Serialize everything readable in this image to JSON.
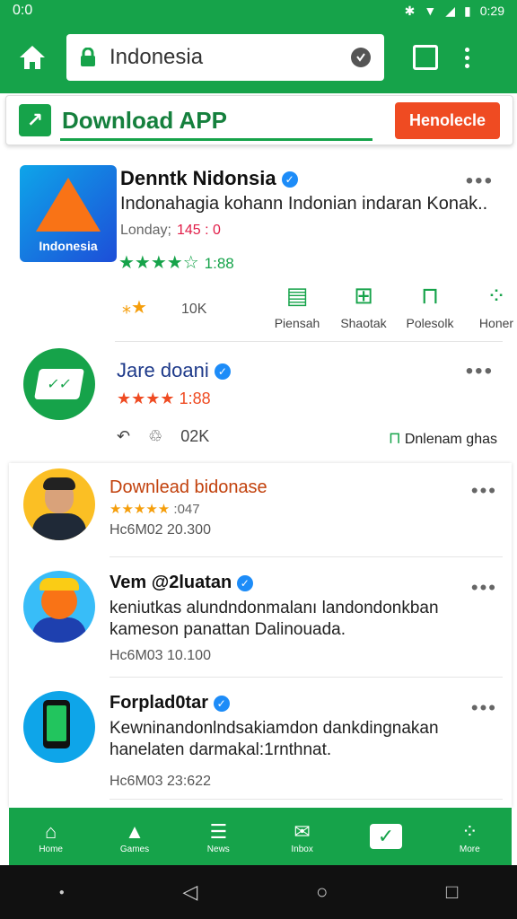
{
  "status_bar": {
    "time_left": "0:0",
    "battery": "0:29"
  },
  "app_bar": {
    "url": "Indonesia"
  },
  "banner": {
    "text": "Download APP",
    "button": "Henolecle"
  },
  "app1": {
    "icon_label": "Indonesia",
    "title": "Denntk Nidonsia",
    "description": "Indonahagia kohann Indonian indaran Konak..",
    "meta_label": "Londay;",
    "meta_value": "145 : 0",
    "stars": "★★★★☆",
    "rating_value": "1:88",
    "downloads_icon": "⁎★",
    "downloads": "10K",
    "actions": [
      {
        "icon": "book-icon",
        "glyph": "▤",
        "label": "Piensah"
      },
      {
        "icon": "robot-icon",
        "glyph": "⊞",
        "label": "Shaotak"
      },
      {
        "icon": "bag-icon",
        "glyph": "⊓",
        "label": "Polesolk"
      },
      {
        "icon": "grid-icon",
        "glyph": "⁘",
        "label": "Honer"
      }
    ]
  },
  "app2": {
    "title": "Jare doani",
    "stars": "★★★★",
    "rating_value": "1:88",
    "downloads": "02K",
    "cta": "Dnlenam ghas"
  },
  "posts": [
    {
      "title": "Downlead bidonase",
      "stars": "★★★★★",
      "sub": ":047",
      "meta": "Hc6M02  20.300",
      "body": []
    },
    {
      "title": "Vem @2luatan",
      "stars": "",
      "sub": "",
      "meta": "Hc6M03  10.100",
      "body": [
        "keniutkas alundndonmalanı landondonkban",
        "kameson panattan Dalinouada."
      ]
    },
    {
      "title": "Forplad0tar",
      "stars": "",
      "sub": "",
      "meta": "Hc6M03  23:622",
      "body": [
        "Kewninandonlndsakiamdon dankdingnakan",
        "hanelaten darmakal:1rnthnat."
      ]
    }
  ],
  "bottom_nav": [
    {
      "label": "Home",
      "glyph": "⌂"
    },
    {
      "label": "Games",
      "glyph": "▲"
    },
    {
      "label": "News",
      "glyph": "☰"
    },
    {
      "label": "Inbox",
      "glyph": "✉"
    },
    {
      "label": "",
      "glyph": "✓"
    },
    {
      "label": "More",
      "glyph": "⁘"
    }
  ],
  "colors": {
    "primary": "#16a34a",
    "accent": "#ef4b22",
    "verified": "#1d8cf8"
  }
}
